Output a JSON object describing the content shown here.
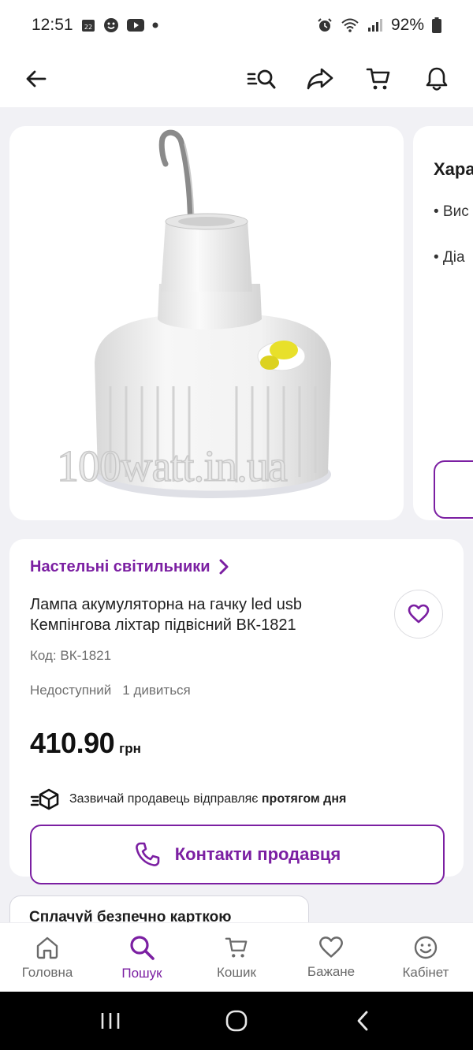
{
  "status_bar": {
    "time": "12:51",
    "calendar_day": "22",
    "battery": "92%"
  },
  "top_nav": {
    "icons": [
      "back-arrow-icon",
      "search-list-icon",
      "share-icon",
      "cart-icon",
      "bell-icon"
    ]
  },
  "gallery": {
    "watermark": "100watt.in.ua"
  },
  "characteristics": {
    "title": "Хара",
    "items": [
      "• Вис",
      "• Діа"
    ]
  },
  "product": {
    "category": "Настельні світильники",
    "title": "Лампа акумуляторна на гачку led usb Кемпінгова ліхтар підвісний ВК-1821",
    "code": "Код: ВК-1821",
    "status": "Недоступний",
    "viewers": "1 дивиться",
    "price": "410.90",
    "currency": "грн",
    "shipping_text": "Зазвичай продавець відправляє ",
    "shipping_bold": "протягом дня",
    "contact_label": "Контакти продавця"
  },
  "payment_card": {
    "label": "Сплачуй безпечно карткою"
  },
  "bottom_nav": {
    "items": [
      {
        "label": "Головна",
        "icon": "home-icon"
      },
      {
        "label": "Пошук",
        "icon": "search-icon"
      },
      {
        "label": "Кошик",
        "icon": "cart-icon"
      },
      {
        "label": "Бажане",
        "icon": "heart-icon"
      },
      {
        "label": "Кабінет",
        "icon": "smile-icon"
      }
    ],
    "active_index": 1
  },
  "colors": {
    "accent": "#7b1fa2",
    "background": "#f1f1f5",
    "lamp_button": "#e8e02a"
  }
}
